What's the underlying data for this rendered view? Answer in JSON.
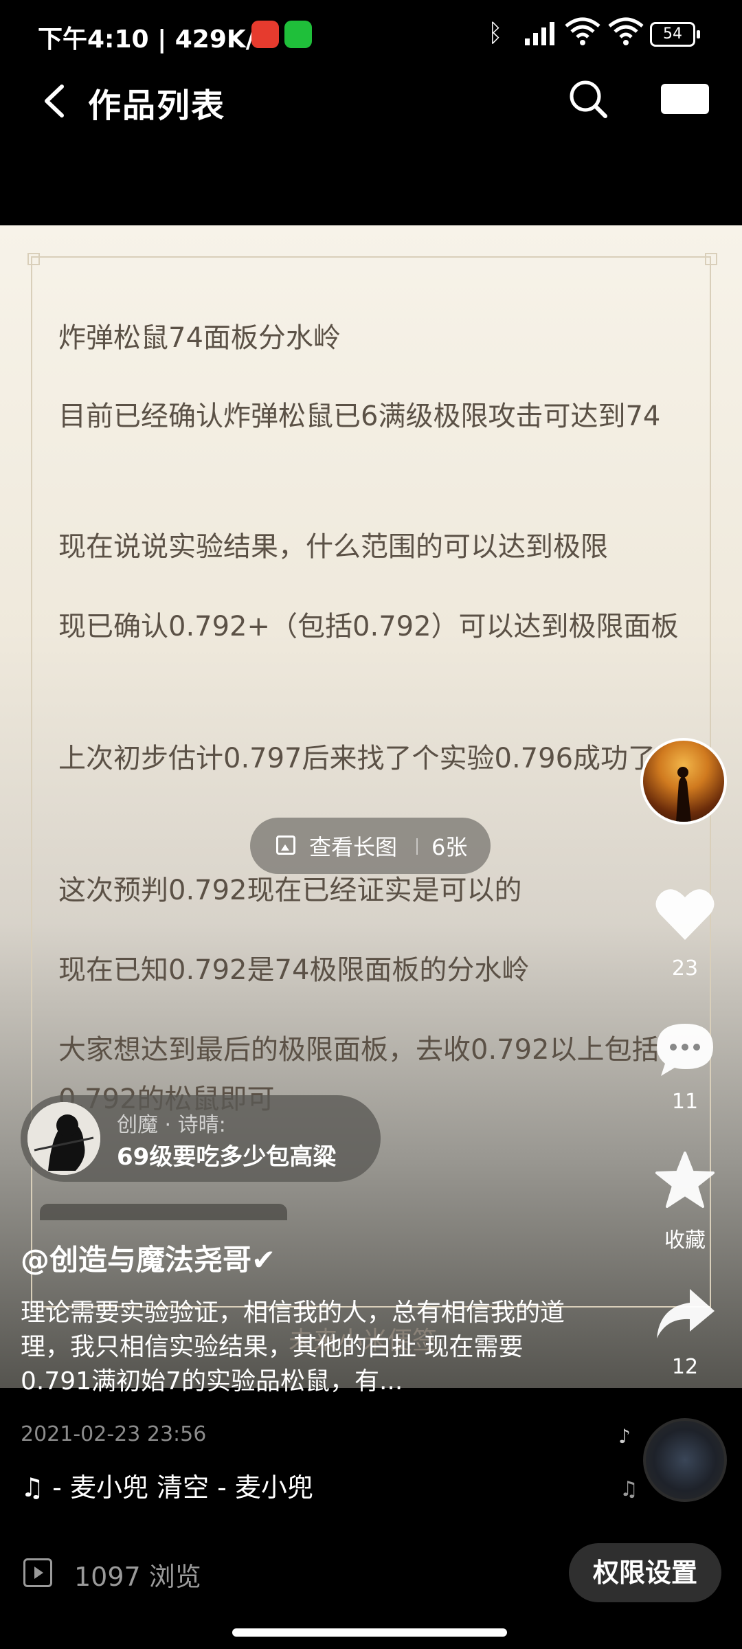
{
  "status_bar": {
    "time_speed": "下午4:10 | 429K/s",
    "battery": "54"
  },
  "header": {
    "title": "作品列表"
  },
  "post_image": {
    "paragraphs": [
      "炸弹松鼠74面板分水岭",
      "目前已经确认炸弹松鼠已6满级极限攻击可达到74",
      "现在说说实验结果，什么范围的可以达到极限",
      "现已确认0.792+（包括0.792）可以达到极限面板",
      "上次初步估计0.797后来找了个实验0.796成功了，",
      "这次预判0.792现在已经证实是可以的",
      "现在已知0.792是74极限面板的分水岭",
      "大家想达到最后的极限面板，去收0.792以上包括0.792的松鼠即可"
    ],
    "footer_text": "未来小米便签",
    "view_long": {
      "label": "查看长图",
      "count": "6张"
    }
  },
  "comment_bubble": {
    "name": "创魔 · 诗晴:",
    "text": "69级要吃多少包高粱"
  },
  "rail": {
    "likes": "23",
    "comments": "11",
    "favorite_label": "收藏",
    "shares": "12"
  },
  "post": {
    "author": "@创造与魔法尧哥✔",
    "description": "理论需要实验验证，相信我的人，总有相信我的道理，我只相信实验结果，其他的白扯 现在需要0.791满初始7的实验品松鼠，有...",
    "date": "2021-02-23 23:56",
    "music": " - 麦小兜    清空 - 麦小兜"
  },
  "footer": {
    "views": "1097 浏览",
    "permission_button": "权限设置"
  }
}
